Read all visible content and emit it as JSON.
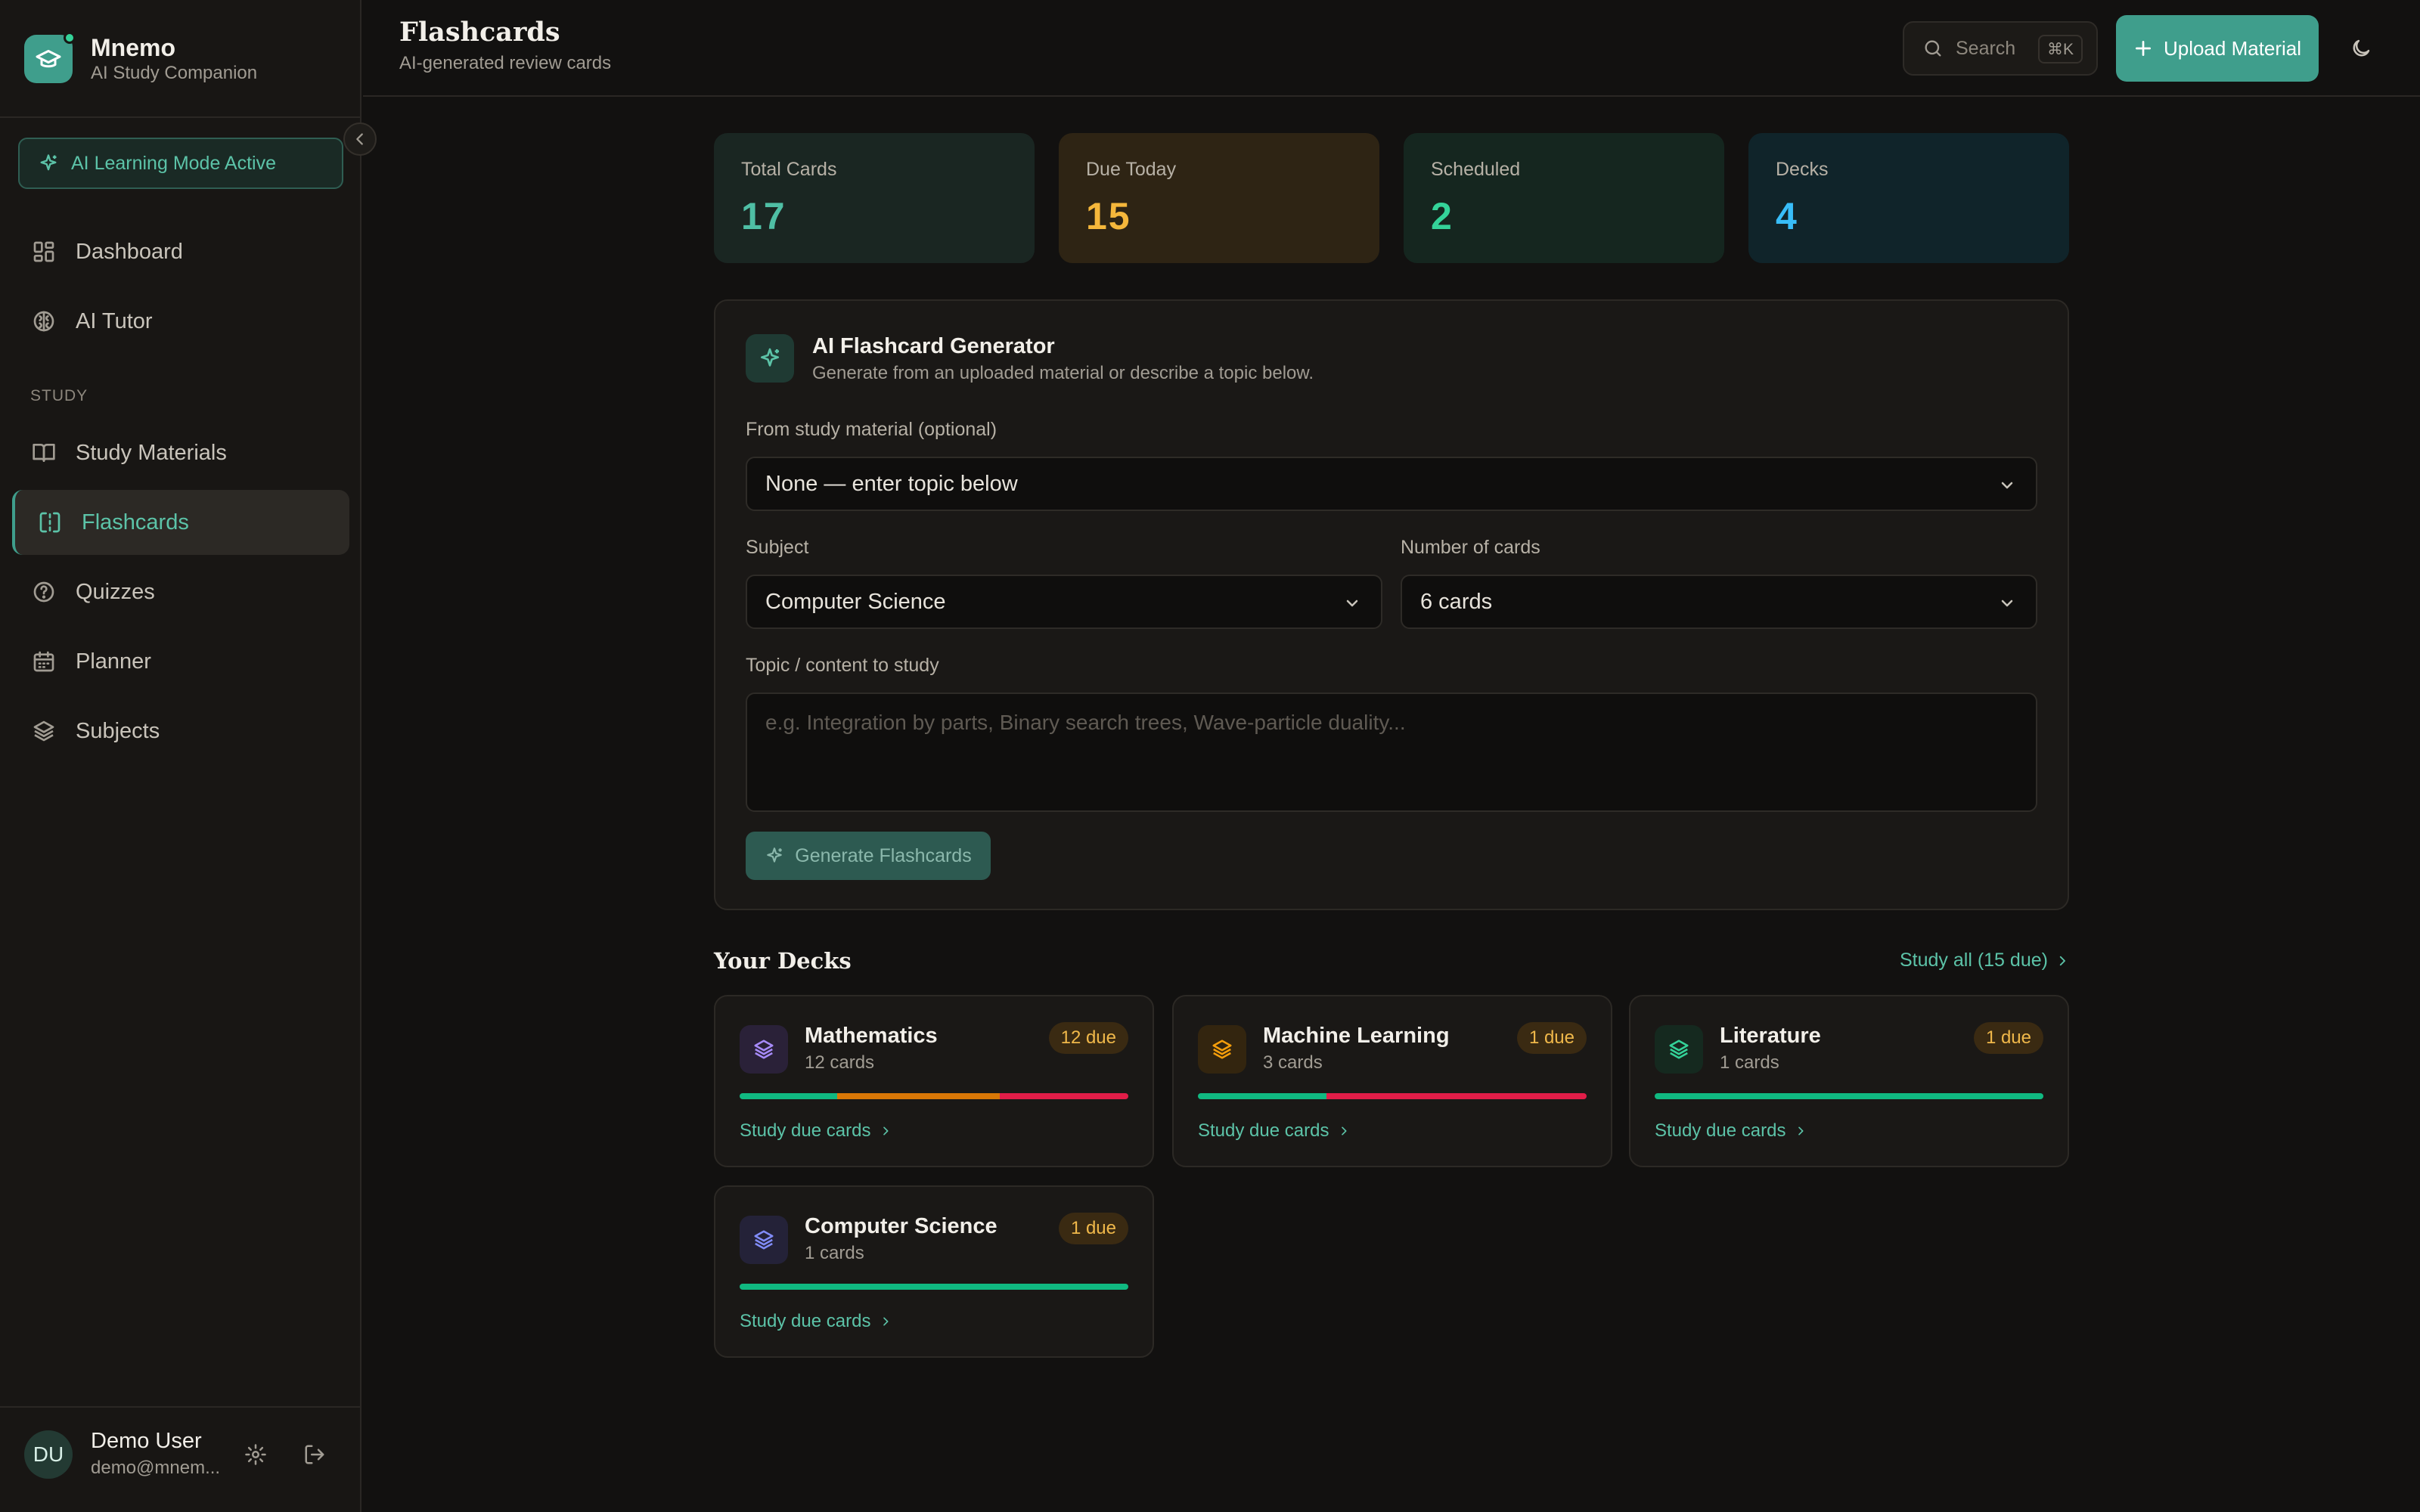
{
  "brand": {
    "name": "Mnemo",
    "subtitle": "AI Study Companion"
  },
  "ai_mode": {
    "label": "AI Learning Mode Active"
  },
  "nav": {
    "primary": [
      {
        "label": "Dashboard",
        "icon": "dashboard-icon"
      },
      {
        "label": "AI Tutor",
        "icon": "brain-icon"
      }
    ],
    "section_label": "STUDY",
    "study": [
      {
        "label": "Study Materials",
        "icon": "book-icon"
      },
      {
        "label": "Flashcards",
        "icon": "flashcards-icon",
        "active": true
      },
      {
        "label": "Quizzes",
        "icon": "question-icon"
      },
      {
        "label": "Planner",
        "icon": "calendar-icon"
      },
      {
        "label": "Subjects",
        "icon": "layers-icon"
      }
    ]
  },
  "user": {
    "initials": "DU",
    "name": "Demo User",
    "email": "demo@mnem..."
  },
  "header": {
    "title": "Flashcards",
    "subtitle": "AI-generated review cards",
    "search_placeholder": "Search",
    "search_shortcut": "⌘K",
    "upload_label": "Upload Material"
  },
  "stats": [
    {
      "label": "Total Cards",
      "value": "17",
      "color": "#4fbfa5",
      "bg": "#1a2622"
    },
    {
      "label": "Due Today",
      "value": "15",
      "color": "#f5b73b",
      "bg": "#2e2414"
    },
    {
      "label": "Scheduled",
      "value": "2",
      "color": "#34d399",
      "bg": "#15261f"
    },
    {
      "label": "Decks",
      "value": "4",
      "color": "#38bdf8",
      "bg": "#10242a"
    }
  ],
  "generator": {
    "title": "AI Flashcard Generator",
    "subtitle": "Generate from an uploaded material or describe a topic below.",
    "material_label": "From study material (optional)",
    "material_value": "None — enter topic below",
    "subject_label": "Subject",
    "subject_value": "Computer Science",
    "count_label": "Number of cards",
    "count_value": "6 cards",
    "topic_label": "Topic / content to study",
    "topic_placeholder": "e.g. Integration by parts, Binary search trees, Wave-particle duality...",
    "button_label": "Generate Flashcards"
  },
  "decks_section": {
    "title": "Your Decks",
    "study_all": "Study all (15 due)"
  },
  "decks": [
    {
      "name": "Mathematics",
      "count": "12 cards",
      "due": "12 due",
      "icon_bg": "#2a2138",
      "icon_color": "#a78bfa",
      "bar": [
        {
          "fraction": 0.25,
          "color": "#10b981"
        },
        {
          "fraction": 0.42,
          "color": "#d97706"
        },
        {
          "fraction": 0.33,
          "color": "#e11d48"
        }
      ],
      "link": "Study due cards"
    },
    {
      "name": "Machine Learning",
      "count": "3 cards",
      "due": "1 due",
      "icon_bg": "#33250f",
      "icon_color": "#f59e0b",
      "bar": [
        {
          "fraction": 0.33,
          "color": "#10b981"
        },
        {
          "fraction": 0.67,
          "color": "#e11d48"
        }
      ],
      "link": "Study due cards"
    },
    {
      "name": "Literature",
      "count": "1 cards",
      "due": "1 due",
      "icon_bg": "#15291f",
      "icon_color": "#34d399",
      "bar": [
        {
          "fraction": 1.0,
          "color": "#10b981"
        }
      ],
      "link": "Study due cards"
    },
    {
      "name": "Computer Science",
      "count": "1 cards",
      "due": "1 due",
      "icon_bg": "#242238",
      "icon_color": "#818cf8",
      "bar": [
        {
          "fraction": 1.0,
          "color": "#10b981"
        }
      ],
      "link": "Study due cards"
    }
  ]
}
